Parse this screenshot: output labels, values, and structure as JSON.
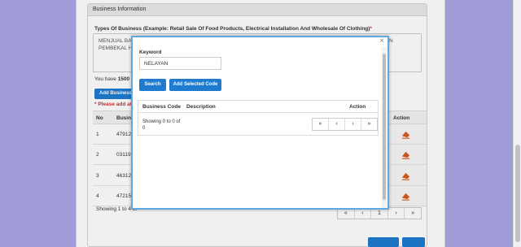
{
  "card": {
    "heading": "Business Information",
    "types_label": "Types Of Business (Example: Retail Sale Of Food Products, Electrical Installation And Wholesale Of Clothing)",
    "types_required": "*",
    "textarea_line1": "MENJUAL BAR",
    "textarea_line2": "PEMBEKAL HA",
    "textarea_right": "N",
    "chars_prefix": "You have ",
    "chars_count": "1500",
    "chars_suffix": " ch",
    "add_business_label": "Add Business Co",
    "please_add": "* Please add at l"
  },
  "business_table": {
    "headers": [
      "No",
      "Busine",
      "Action"
    ],
    "rows": [
      {
        "no": "1",
        "code": "47912"
      },
      {
        "no": "2",
        "code": "03119"
      },
      {
        "no": "3",
        "code": "46312"
      },
      {
        "no": "4",
        "code": "47215"
      }
    ],
    "showing": "Showing 1 to 4 of",
    "pager": [
      "«",
      "‹",
      "1",
      "›",
      "»"
    ]
  },
  "modal": {
    "close": "×",
    "keyword_label": "Keyword",
    "keyword_value": "NELAYAN",
    "search_label": "Search",
    "add_selected_label": "Add Selected Code",
    "headers": [
      "Business Code",
      "Description",
      "Action"
    ],
    "showing_line1": "Showing 0 to 0 of",
    "showing_line2": "0",
    "pager": [
      "«",
      "‹",
      "›",
      "»"
    ]
  },
  "colors": {
    "primary": "#1f7bd0",
    "danger": "#d9302a",
    "background": "#a9a6e6",
    "modal_border": "#5fa8e0"
  },
  "icons": {
    "delete": "eraser-icon"
  }
}
